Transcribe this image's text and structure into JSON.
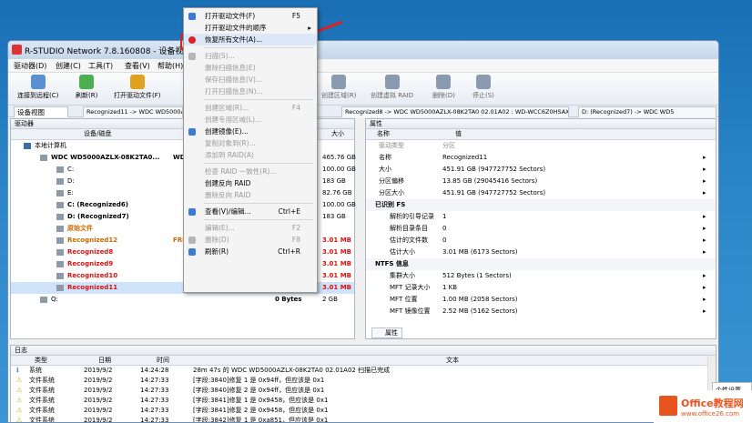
{
  "window": {
    "title": "R-STUDIO Network 7.8.160808 - 设备视图"
  },
  "menubar": [
    "驱动器(D)",
    "创建(C)",
    "工具(T)",
    "查看(V)",
    "帮助(H)"
  ],
  "toolbar": [
    {
      "label": "连接到远程(C)",
      "icon": "remote-icon"
    },
    {
      "label": "刷新(R)",
      "icon": "refresh-icon"
    },
    {
      "label": "打开驱动文件(F)",
      "icon": "open-icon"
    },
    {
      "label": "创建区域(R)",
      "icon": "region-icon"
    },
    {
      "label": "创建虚拟 RAID",
      "icon": "raid-icon"
    },
    {
      "label": "删除(D)",
      "icon": "delete-icon"
    },
    {
      "label": "停止(S)",
      "icon": "stop-icon"
    }
  ],
  "tabs": [
    "设备视图",
    "Recognized11 -> WDC WD5000AZLX...",
    "Recognized8 -> WDC WD5000AZLX-08K2TA0 02.01A02 : WD-WCC6Z0HSAXJD",
    "D: (Recognized7) -> WDC WD5"
  ],
  "left_pane": {
    "title": "驱动器",
    "col_device": "设备/磁盘",
    "col_size": "大小",
    "rows": [
      {
        "name": "本地计算机",
        "label": "",
        "size": "",
        "style": "normal",
        "indent": 0
      },
      {
        "name": "WDC WD5000AZLX-08K2TA0...",
        "label": "WD-",
        "size": "465.76 GB",
        "style": "bold",
        "indent": 1
      },
      {
        "name": "C:",
        "label": "",
        "size": "100.00 GB",
        "style": "normal",
        "indent": 2
      },
      {
        "name": "D:",
        "label": "",
        "size": "183 GB",
        "style": "normal",
        "indent": 2
      },
      {
        "name": "E:",
        "label": "",
        "size": "82.76 GB",
        "style": "normal",
        "indent": 2
      },
      {
        "name": "C: (Recognized6)",
        "label": "",
        "size": "100.00 GB",
        "style": "bold",
        "indent": 2
      },
      {
        "name": "D: (Recognized7)",
        "label": "",
        "size": "183 GB",
        "style": "bold",
        "indent": 2
      },
      {
        "name": "原始文件",
        "label": "",
        "size": "",
        "style": "orange",
        "indent": 2
      },
      {
        "name": "Recognized12",
        "label": "FREE",
        "size": "3.01 MB",
        "style": "orange",
        "indent": 2
      },
      {
        "name": "Recognized8",
        "label": "",
        "size": "3.01 MB",
        "style": "red",
        "indent": 2
      },
      {
        "name": "Recognized9",
        "label": "",
        "size": "3.01 MB",
        "style": "red",
        "indent": 2
      },
      {
        "name": "Recognized10",
        "label": "",
        "size": "3.01 MB",
        "style": "red",
        "indent": 2
      },
      {
        "name": "Recognized11",
        "label": "",
        "size": "3.01 MB",
        "style": "red-sel",
        "indent": 2
      },
      {
        "name": "Q:",
        "label": "0 Bytes",
        "size": "2 GB",
        "style": "normal",
        "indent": 1
      }
    ]
  },
  "right_pane": {
    "title": "属性",
    "col_name": "名称",
    "col_value": "值",
    "rows": [
      {
        "name": "驱动类型",
        "value": "分区",
        "kind": "gray"
      },
      {
        "name": "名称",
        "value": "Recognized11",
        "kind": "prop"
      },
      {
        "name": "大小",
        "value": "451.91 GB (947727752 Sectors)",
        "kind": "prop"
      },
      {
        "name": "分区偏移",
        "value": "13.85 GB (29045416 Sectors)",
        "kind": "prop"
      },
      {
        "name": "分区大小",
        "value": "451.91 GB (947727752 Sectors)",
        "kind": "prop"
      },
      {
        "name": "已识别 FS",
        "value": "",
        "kind": "group"
      },
      {
        "name": "解析的引导记录",
        "value": "1",
        "kind": "sub"
      },
      {
        "name": "解析目录条目",
        "value": "0",
        "kind": "sub"
      },
      {
        "name": "估计的文件数",
        "value": "0",
        "kind": "sub"
      },
      {
        "name": "估计大小",
        "value": "3.01 MB (6173 Sectors)",
        "kind": "sub"
      },
      {
        "name": "NTFS 信息",
        "value": "",
        "kind": "group"
      },
      {
        "name": "集群大小",
        "value": "512 Bytes (1 Sectors)",
        "kind": "sub"
      },
      {
        "name": "MFT 记录大小",
        "value": "1 KB",
        "kind": "sub"
      },
      {
        "name": "MFT 位置",
        "value": "1.00 MB (2058 Sectors)",
        "kind": "sub"
      },
      {
        "name": "MFT 镜像位置",
        "value": "2.52 MB (5162 Sectors)",
        "kind": "sub"
      }
    ],
    "footer_tab": "属性"
  },
  "log": {
    "title": "日志",
    "cols": [
      "类型",
      "日期",
      "时间",
      "文本"
    ],
    "rows": [
      {
        "type": "系统",
        "date": "2019/9/2",
        "time": "14:24:28",
        "text": "28m 47s 的 WDC WD5000AZLX-08K2TA0 02.01A02 扫描已完成",
        "icon": "info"
      },
      {
        "type": "文件系统",
        "date": "2019/9/2",
        "time": "14:27:33",
        "text": "[字段:3840]修复 1 是 0x94ff，但应该是 0x1",
        "icon": "warn"
      },
      {
        "type": "文件系统",
        "date": "2019/9/2",
        "time": "14:27:33",
        "text": "[字段:3840]修复 2 是 0x94ff，但应该是 0x1",
        "icon": "warn"
      },
      {
        "type": "文件系统",
        "date": "2019/9/2",
        "time": "14:27:33",
        "text": "[字段:3841]修复 1 是 0x9458，但应该是 0x1",
        "icon": "warn"
      },
      {
        "type": "文件系统",
        "date": "2019/9/2",
        "time": "14:27:33",
        "text": "[字段:3841]修复 2 是 0x9458，但应该是 0x1",
        "icon": "warn"
      },
      {
        "type": "文件系统",
        "date": "2019/9/2",
        "time": "14:27:33",
        "text": "[字段:3842]修复 1 是 0xa851，但应该是 0x1",
        "icon": "warn"
      }
    ]
  },
  "context_menu": [
    {
      "label": "打开驱动文件(F)",
      "shortcut": "F5",
      "enabled": true,
      "icon": "open-file-icon"
    },
    {
      "label": "打开驱动文件的顺序",
      "shortcut": "",
      "enabled": true,
      "icon": "",
      "submenu": true
    },
    {
      "label": "恢复所有文件(A)...",
      "shortcut": "",
      "enabled": true,
      "icon": "recover-icon"
    },
    {
      "sep": true
    },
    {
      "label": "扫描(S)...",
      "shortcut": "",
      "enabled": false,
      "icon": "scan-icon"
    },
    {
      "label": "删除扫描信息(E)",
      "shortcut": "",
      "enabled": false,
      "icon": ""
    },
    {
      "label": "保存扫描信息(V)...",
      "shortcut": "",
      "enabled": false,
      "icon": ""
    },
    {
      "label": "打开扫描信息(N)...",
      "shortcut": "",
      "enabled": false,
      "icon": ""
    },
    {
      "sep": true
    },
    {
      "label": "创建区域(R)...",
      "shortcut": "F4",
      "enabled": false,
      "icon": ""
    },
    {
      "label": "创建专用区域(L)...",
      "shortcut": "",
      "enabled": false,
      "icon": ""
    },
    {
      "label": "创建镜像(E)...",
      "shortcut": "",
      "enabled": true,
      "icon": "image-icon"
    },
    {
      "label": "复制对象到(R)...",
      "shortcut": "",
      "enabled": false,
      "icon": ""
    },
    {
      "label": "添加到 RAID(A)",
      "shortcut": "",
      "enabled": false,
      "icon": ""
    },
    {
      "sep": true
    },
    {
      "label": "检查 RAID 一致性(R)...",
      "shortcut": "",
      "enabled": false,
      "icon": ""
    },
    {
      "label": "创建反向 RAID",
      "shortcut": "",
      "enabled": true,
      "icon": ""
    },
    {
      "label": "删除反向 RAID",
      "shortcut": "",
      "enabled": false,
      "icon": ""
    },
    {
      "sep": true
    },
    {
      "label": "查看(V)/编辑...",
      "shortcut": "Ctrl+E",
      "enabled": true,
      "icon": "view-icon"
    },
    {
      "sep": true
    },
    {
      "label": "编辑(E)...",
      "shortcut": "F2",
      "enabled": false,
      "icon": ""
    },
    {
      "label": "删除(D)",
      "shortcut": "F8",
      "enabled": false,
      "icon": "delete-icon"
    },
    {
      "label": "刷新(R)",
      "shortcut": "Ctrl+R",
      "enabled": true,
      "icon": "refresh-icon"
    }
  ],
  "helper": "个性设置",
  "watermark": {
    "brand": "Office教程网",
    "url": "www.office26.com"
  }
}
